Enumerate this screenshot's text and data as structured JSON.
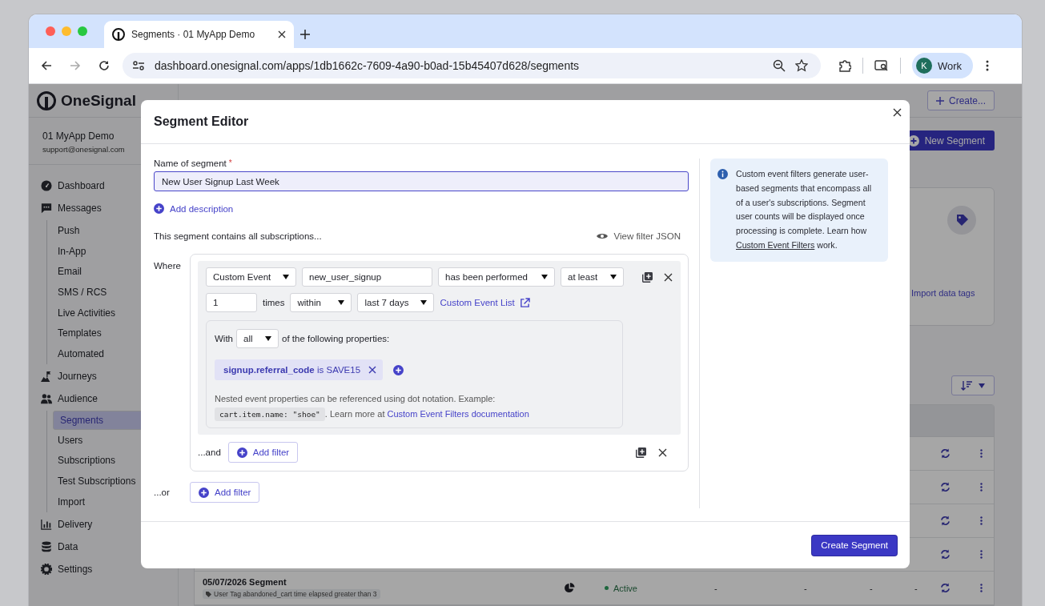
{
  "browser": {
    "tabs": [
      {
        "title": "Segments · 01 MyApp Demo",
        "selected": true
      }
    ],
    "url": "dashboard.onesignal.com/apps/1db1662c-7609-4a90-b0ad-15b45407d628/segments",
    "profile": {
      "initial": "K",
      "name": "Work"
    }
  },
  "sidebar": {
    "brand": "OneSignal",
    "app_name": "01 MyApp Demo",
    "email": "support@onesignal.com",
    "items": [
      {
        "label": "Dashboard",
        "kind": "dashboard"
      },
      {
        "label": "Messages",
        "kind": "messages",
        "children": [
          {
            "label": "Push",
            "selected": false
          },
          {
            "label": "In-App",
            "selected": false
          },
          {
            "label": "Email",
            "selected": false
          },
          {
            "label": "SMS / RCS",
            "selected": false
          },
          {
            "label": "Live Activities",
            "selected": false
          },
          {
            "label": "Templates",
            "selected": false
          },
          {
            "label": "Automated",
            "selected": false
          }
        ]
      },
      {
        "label": "Journeys",
        "kind": "journeys"
      },
      {
        "label": "Audience",
        "kind": "audience",
        "children": [
          {
            "label": "Segments",
            "selected": true
          },
          {
            "label": "Users",
            "selected": false
          },
          {
            "label": "Subscriptions",
            "selected": false
          },
          {
            "label": "Test Subscriptions",
            "selected": false
          },
          {
            "label": "Import",
            "selected": false
          }
        ]
      },
      {
        "label": "Delivery",
        "kind": "delivery"
      },
      {
        "label": "Data",
        "kind": "data"
      },
      {
        "label": "Settings",
        "kind": "settings"
      }
    ]
  },
  "page": {
    "create_button": "Create...",
    "new_segment_button": "New Segment",
    "import_link": "Import data tags",
    "table": {
      "rows": [
        {
          "covered": true
        },
        {
          "covered": true
        },
        {
          "covered": true
        },
        {
          "covered": true
        },
        {
          "covered": false,
          "name": "05/07/2026 Segment",
          "filter": "User Tag abandoned_cart time elapsed greater than 3",
          "status": "Active",
          "cells": [
            "-",
            "-",
            "-",
            "-"
          ]
        }
      ]
    }
  },
  "modal": {
    "title": "Segment Editor",
    "name_label": "Name of segment",
    "required_mark": "*",
    "name_value": "New User Signup Last Week",
    "add_description": "Add description",
    "contains_text": "This segment contains all subscriptions...",
    "view_json": "View filter JSON",
    "where_label": "Where",
    "filter": {
      "event_type": "Custom Event",
      "event_name": "new_user_signup",
      "operator": "has been performed",
      "comparator": "at least",
      "count": "1",
      "times_label": "times",
      "window": "within",
      "period": "last 7 days",
      "list_link": "Custom Event List",
      "with_label": "With",
      "quantifier": "all",
      "properties_label": "of the following properties:",
      "properties": [
        {
          "text": "**signup.referral_code** is SAVE15"
        }
      ],
      "note": "Nested event properties can be referenced using dot notation. Example:",
      "code": "cart.item.name: \"shoe\"",
      "learn_more": ". Learn more at",
      "doc_link": "Custom Event Filters documentation"
    },
    "and_label": "...and",
    "and_button": "Add filter",
    "or_label": "...or",
    "or_button": "Add filter",
    "info": {
      "text": "Custom event filters generate user-based segments that encompass all of a user's subscriptions. Segment user counts will be displayed once processing is complete. Learn how",
      "link": "Custom Event Filters",
      "after": "work."
    },
    "submit": "Create Segment"
  }
}
